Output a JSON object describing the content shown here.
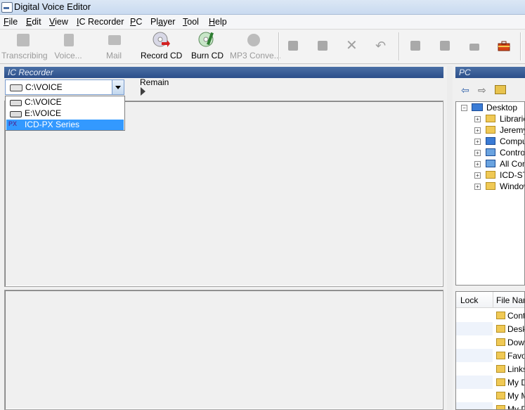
{
  "window": {
    "title": "Digital Voice Editor"
  },
  "menu": [
    {
      "label": "File",
      "accel": "F"
    },
    {
      "label": "Edit",
      "accel": "E"
    },
    {
      "label": "View",
      "accel": "V"
    },
    {
      "label": "IC Recorder",
      "accel": "I"
    },
    {
      "label": "PC",
      "accel": "P"
    },
    {
      "label": "Player",
      "accel": "a"
    },
    {
      "label": "Tool",
      "accel": "T"
    },
    {
      "label": "Help",
      "accel": "H"
    }
  ],
  "toolbar": {
    "transcribing": "Transcribing",
    "voice": "Voice...",
    "mail": "Mail",
    "record_cd": "Record CD",
    "burn_cd": "Burn CD",
    "mp3_convert": "MP3 Conve..."
  },
  "ic_recorder": {
    "header": "IC Recorder",
    "selected_drive": "C:\\VOICE",
    "remain_label": "Remain",
    "options": [
      {
        "label": "C:\\VOICE",
        "icon": "drive-icon"
      },
      {
        "label": "E:\\VOICE",
        "icon": "drive-icon"
      },
      {
        "label": "ICD-PX Series",
        "icon": "px-device-icon",
        "badge": "PX"
      }
    ]
  },
  "pc": {
    "header": "PC",
    "tree": [
      {
        "label": "Desktop",
        "icon": "desktop-icon"
      },
      {
        "label": "Libraries",
        "icon": "libraries-icon"
      },
      {
        "label": "Jeremy",
        "icon": "user-folder-icon"
      },
      {
        "label": "Computer",
        "icon": "computer-icon"
      },
      {
        "label": "Control Panel",
        "icon": "control-panel-icon"
      },
      {
        "label": "All Control Panel Items",
        "icon": "control-panel-icon"
      },
      {
        "label": "ICD-ST",
        "icon": "folder-icon"
      },
      {
        "label": "Windows",
        "icon": "folder-icon"
      }
    ],
    "columns": [
      "Lock",
      "File Name"
    ],
    "files": [
      "Contacts",
      "Desktop",
      "Downloads",
      "Favorites",
      "Links",
      "My Documents",
      "My Music",
      "My Pictures"
    ]
  },
  "colors": {
    "selection": "#3399ff",
    "panel_header": "#2c4f8a"
  }
}
